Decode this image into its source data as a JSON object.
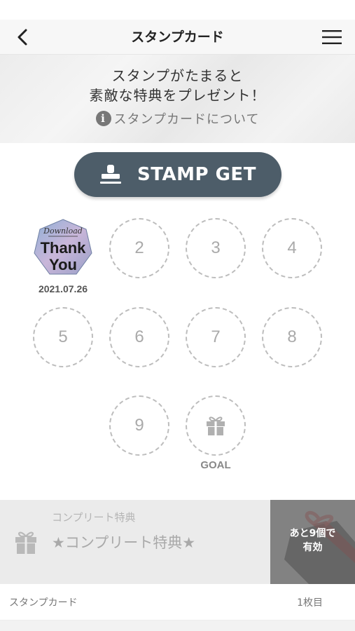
{
  "nav": {
    "title": "スタンプカード",
    "back_icon": "chevron-left-icon",
    "menu_icon": "hamburger-menu-icon"
  },
  "banner": {
    "line1": "スタンプがたまると",
    "line2": "素敵な特典をプレゼント！",
    "about_link": "スタンプカードについて",
    "info_icon_glyph": "i"
  },
  "stamp_button": {
    "label": "STAMP GET",
    "icon": "stamp-icon",
    "color": "#4d5d69"
  },
  "stamp_card": {
    "stamped": [
      {
        "position": 1,
        "stamp_text_top": "Download",
        "stamp_text_main": [
          "Thank",
          "You"
        ],
        "date": "2021.07.26"
      }
    ],
    "empty_slots": [
      "2",
      "3",
      "4",
      "5",
      "6",
      "7",
      "8",
      "9"
    ],
    "goal_label": "GOAL",
    "goal_icon": "gift-icon"
  },
  "reward": {
    "subtitle": "コンプリート特典",
    "title": "★コンプリート特典★",
    "icon": "gift-icon",
    "thumb_line1": "あと9個で",
    "thumb_line2": "有効"
  },
  "footer": {
    "left": "スタンプカード",
    "right": "1枚目"
  }
}
